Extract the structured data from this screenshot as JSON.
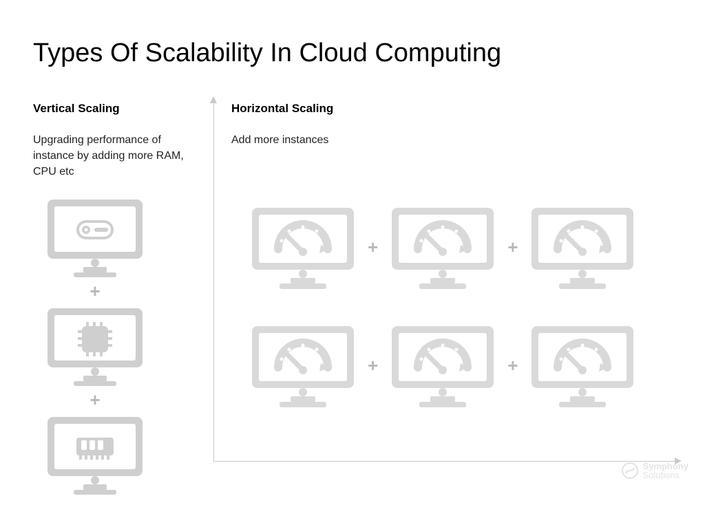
{
  "title": "Types Of Scalability In Cloud Computing",
  "vertical": {
    "heading": "Vertical Scaling",
    "description": "Upgrading performance of instance by adding more RAM, CPU etc",
    "items": [
      {
        "icon": "disk-icon"
      },
      {
        "icon": "cpu-chip-icon"
      },
      {
        "icon": "ram-module-icon"
      }
    ],
    "joiner": "+"
  },
  "horizontal": {
    "heading": "Horizontal Scaling",
    "description": "Add more instances",
    "rows": 2,
    "instances_per_row": 3,
    "instance_icon": "gauge-icon",
    "joiner": "+"
  },
  "watermark": {
    "line1": "Symphony",
    "line2": "Solutions"
  },
  "colors": {
    "icon_gray": "#cfcfcf",
    "plus_gray": "#b8b8b8",
    "axis_gray": "#c9c9c9"
  }
}
